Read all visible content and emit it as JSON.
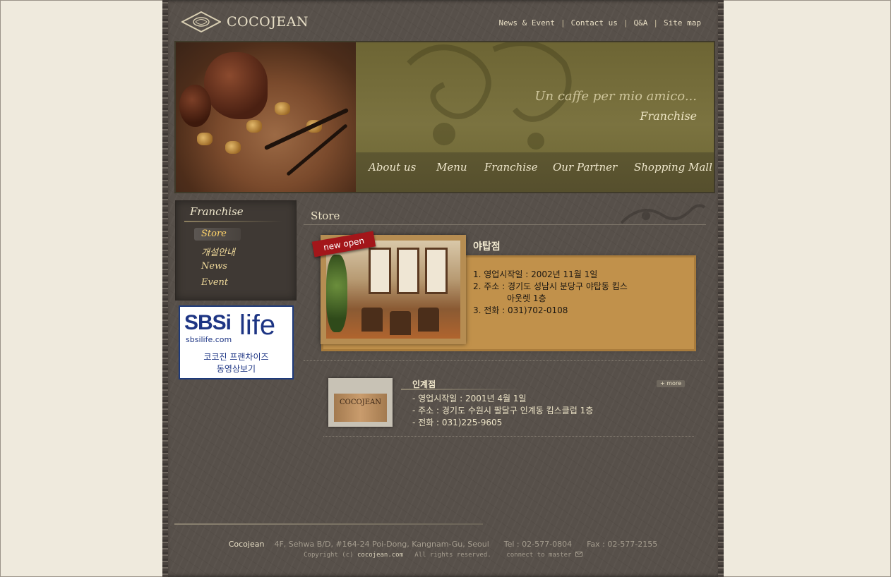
{
  "header": {
    "logo_text": "COCOJEAN",
    "top_links": [
      "News & Event",
      "Contact us",
      "Q&A",
      "Site map"
    ],
    "separator": "|"
  },
  "banner": {
    "slogan": "Un caffe per mio amico...",
    "subtitle": "Franchise",
    "main_nav": [
      "About us",
      "Menu",
      "Franchise",
      "Our Partner",
      "Shopping Mall"
    ]
  },
  "sidebar": {
    "title": "Franchise",
    "items": [
      {
        "label": "Store",
        "active": true
      },
      {
        "label": "개설안내",
        "active": false
      },
      {
        "label": "News",
        "active": false
      },
      {
        "label": "Event",
        "active": false
      }
    ],
    "ad": {
      "brand": "SBSi",
      "brand2": "life",
      "url": "sbsilife.com",
      "line1": "코코진 프랜차이즈",
      "line2": "동영상보기"
    }
  },
  "main": {
    "section_title": "Store",
    "feature": {
      "badge": "new open",
      "name": "야탑점",
      "info": [
        "1. 영업시작일 : 2002년 11월 1일",
        "2. 주소 : 경기도 성남시 분당구 야탑동 킴스",
        "아웃렛 1층",
        "3. 전화 : 031)702-0108"
      ]
    },
    "store2": {
      "name": "인계점",
      "more_label": "+ more",
      "sign_text": "COCOJEAN",
      "info": [
        "- 영업시작일 : 2001년 4월 1일",
        "- 주소 : 경기도 수원시 팔달구 인계동 킴스클럽 1층",
        "- 전화 : 031)225-9605"
      ]
    }
  },
  "footer": {
    "company": "Cocojean",
    "address": "4F, Sehwa B/D, #164-24 Poi-Dong, Kangnam-Gu, Seoul",
    "tel": "Tel : 02-577-0804",
    "fax": "Fax : 02-577-2155",
    "copyright_prefix": "Copyright (c)",
    "site": "cocojean.com",
    "rights": "All rights reserved.",
    "connect": "connect to master"
  },
  "colors": {
    "page_bg": "#efeadd",
    "content_bg": "#57504a",
    "banner_olive": "#7b7340",
    "feature_gold": "#c1914b",
    "ribbon_red": "#a3161a",
    "ad_blue": "#1d3584"
  }
}
